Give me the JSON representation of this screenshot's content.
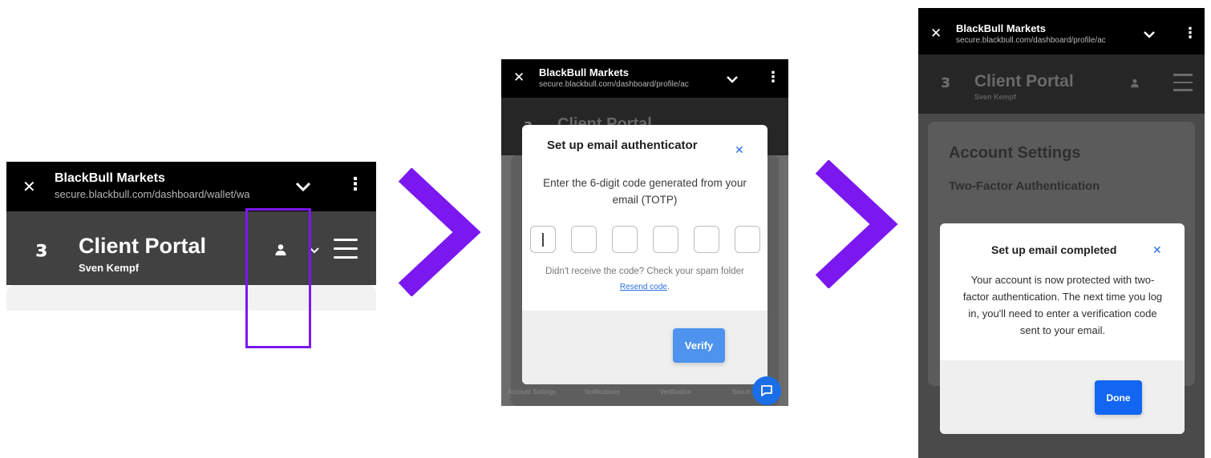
{
  "accent_color": "#7b18ef",
  "browser": {
    "site_name": "BlackBull Markets",
    "close_glyph": "✕",
    "menu_glyph": "⋮",
    "url_wallet": "secure.blackbull.com/dashboard/wallet/wa",
    "url_profile": "secure.blackbull.com/dashboard/profile/ac"
  },
  "portal": {
    "logo_glyph": "ɜ",
    "title": "Client Portal",
    "user_name": "Sven Kempf"
  },
  "step2": {
    "modal_title": "Set up email authenticator",
    "close_glyph": "✕",
    "instructions": "Enter the 6-digit code generated from your email (TOTP)",
    "help_text": "Didn't receive the code? Check your spam folder",
    "resend_link": "Resend code",
    "help_end": ".",
    "verify_label": "Verify",
    "bg_tabs": [
      "Account Settings",
      "Notifications",
      "Verification",
      "Securi"
    ]
  },
  "step3": {
    "page_heading": "Account Settings",
    "section_heading": "Two-Factor Authentication",
    "modal_title": "Set up email completed",
    "close_glyph": "✕",
    "message": "Your account is now protected with two-factor authentication. The next time you log in, you'll need to enter a verification code sent to your email.",
    "done_label": "Done"
  }
}
